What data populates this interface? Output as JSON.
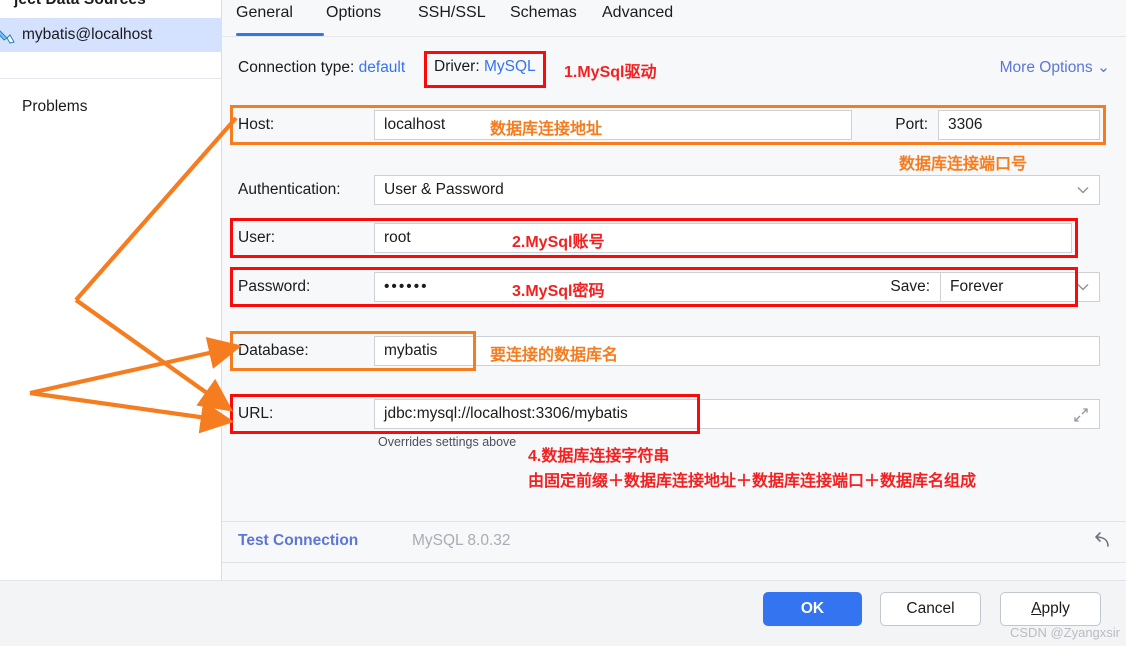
{
  "sidebar": {
    "title": "ject Data Sources",
    "selected_item": "mybatis@localhost",
    "selected_icon": "datasource-icon",
    "problems_label": "Problems",
    "help_label": "?"
  },
  "tabs": [
    {
      "label": "General",
      "active": true
    },
    {
      "label": "Options",
      "active": false
    },
    {
      "label": "SSH/SSL",
      "active": false
    },
    {
      "label": "Schemas",
      "active": false
    },
    {
      "label": "Advanced",
      "active": false
    }
  ],
  "header": {
    "connection_type_label": "Connection type:",
    "connection_type_value": "default",
    "driver_label": "Driver:",
    "driver_value": "MySQL",
    "more_options": "More Options",
    "more_options_icon": "chevron-down-icon"
  },
  "form": {
    "host": {
      "label": "Host:",
      "value": "localhost"
    },
    "port": {
      "label": "Port:",
      "value": "3306"
    },
    "authentication": {
      "label": "Authentication:",
      "value": "User & Password",
      "icon": "chevron-down-icon"
    },
    "user": {
      "label": "User:",
      "value": "root"
    },
    "password": {
      "label": "Password:",
      "value": "••••••"
    },
    "save": {
      "label": "Save:",
      "value": "Forever",
      "icon": "chevron-down-icon"
    },
    "database": {
      "label": "Database:",
      "value": "mybatis"
    },
    "url": {
      "label": "URL:",
      "value": "jdbc:mysql://localhost:3306/mybatis",
      "expand_icon": "expand-arrows-icon"
    },
    "overrides_hint": "Overrides settings above"
  },
  "annotations": {
    "driver": "1.MySql驱动",
    "host": "数据库连接地址",
    "port": "数据库连接端口号",
    "user": "2.MySql账号",
    "password": "3.MySql密码",
    "database": "要连接的数据库名",
    "url_line1": "4.数据库连接字符串",
    "url_line2": "由固定前缀＋数据库连接地址＋数据库连接端口＋数据库名组成"
  },
  "footer": {
    "test_connection": "Test Connection",
    "driver_version": "MySQL 8.0.32",
    "revert_icon": "revert-arrow-icon"
  },
  "buttons": {
    "ok": "OK",
    "cancel": "Cancel",
    "apply_mnemonic": "A",
    "apply_rest": "pply"
  },
  "watermark": "CSDN @Zyangxsir",
  "colors": {
    "accent_blue": "#3574f0",
    "annotation_red": "#f42020",
    "annotation_orange": "#f57c1f",
    "selection_blue": "#d4e2ff"
  }
}
